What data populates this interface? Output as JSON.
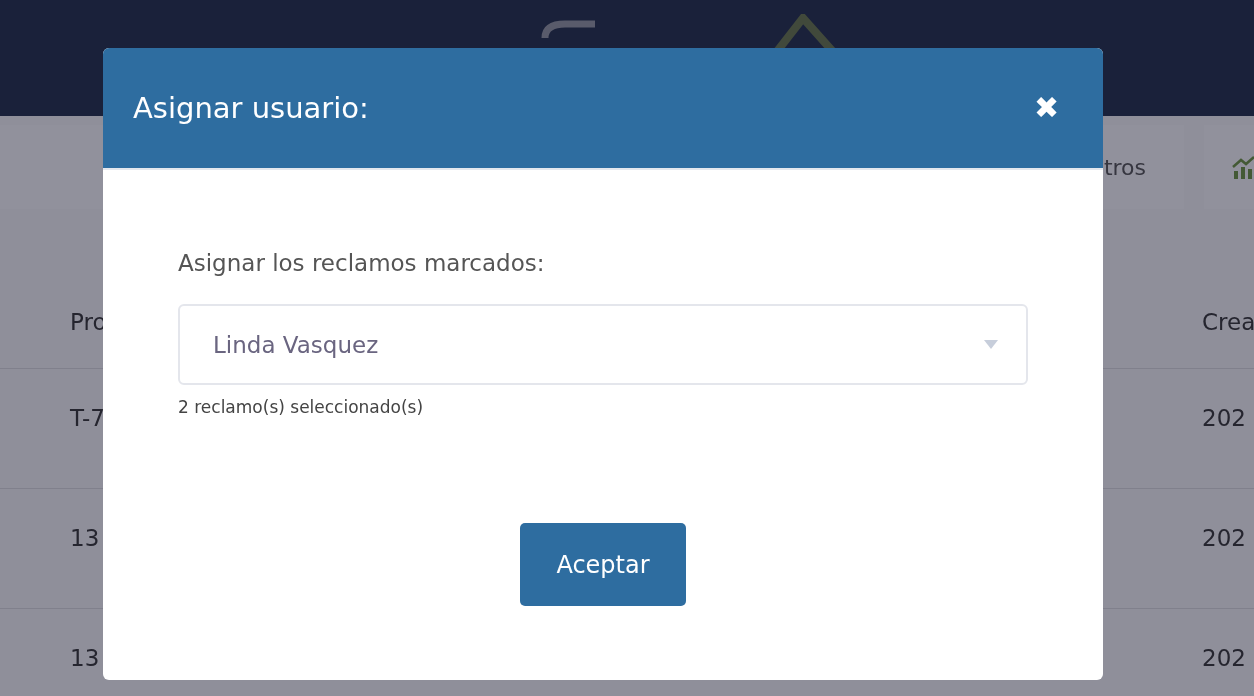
{
  "toolbar": {
    "buttons": [
      {
        "label": "tros",
        "kind": "text"
      },
      {
        "kind": "chart"
      }
    ]
  },
  "table": {
    "columns": [
      "Pro",
      "Crea"
    ],
    "rows": [
      [
        "T-7",
        "202"
      ],
      [
        "13",
        "202"
      ],
      [
        "13",
        "202"
      ]
    ]
  },
  "modal": {
    "title": "Asignar usuario:",
    "close": "✖",
    "label": "Asignar los reclamos marcados:",
    "select": {
      "value": "Linda Vasquez"
    },
    "hint": "2 reclamo(s) seleccionado(s)",
    "button": "Aceptar"
  }
}
